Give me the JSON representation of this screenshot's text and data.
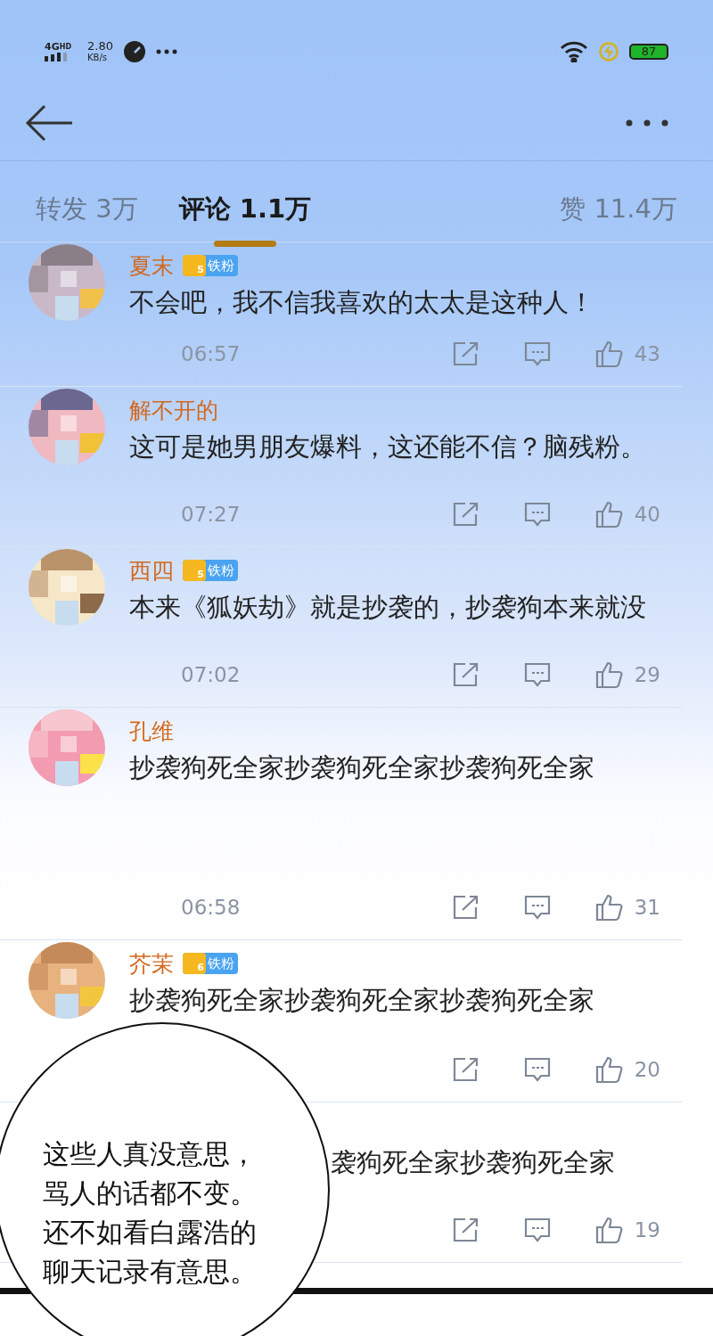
{
  "status_bar": {
    "network": "4G",
    "network_badge": "HD",
    "speed": "2.80",
    "speed_unit": "KB/s",
    "battery": "87"
  },
  "tabs": [
    {
      "label": "转发 3万",
      "selected": false
    },
    {
      "label": "评论 1.1万",
      "selected": true
    },
    {
      "label": "赞 11.4万",
      "selected": false
    }
  ],
  "comments": [
    {
      "name": "夏末",
      "badge": {
        "level": "5",
        "label": "铁粉"
      },
      "text": "不会吧，我不信我喜欢的太太是这种人！",
      "time": "06:57",
      "likes": "43"
    },
    {
      "name": "解不开的",
      "text": "这可是她男朋友爆料，这还能不信？脑残粉。",
      "time": "07:27",
      "likes": "40"
    },
    {
      "name": "西四",
      "badge": {
        "level": "5",
        "label": "铁粉"
      },
      "text": "本来《狐妖劫》就是抄袭的，抄袭狗本来就没",
      "time": "07:02",
      "likes": "29"
    },
    {
      "name": "孔维",
      "text": "抄袭狗死全家抄袭狗死全家抄袭狗死全家",
      "time": "06:58",
      "likes": "31"
    },
    {
      "name": "芥茉",
      "badge": {
        "level": "6",
        "label": "铁粉"
      },
      "text": "抄袭狗死全家抄袭狗死全家抄袭狗死全家",
      "likes": "20"
    },
    {
      "text": "袭狗死全家抄袭狗死全家",
      "likes": "19"
    }
  ],
  "speech_bubble": {
    "lines": [
      "这些人真没意思，",
      "骂人的话都不变。",
      "还不如看白露浩的",
      "聊天记录有意思。"
    ]
  }
}
